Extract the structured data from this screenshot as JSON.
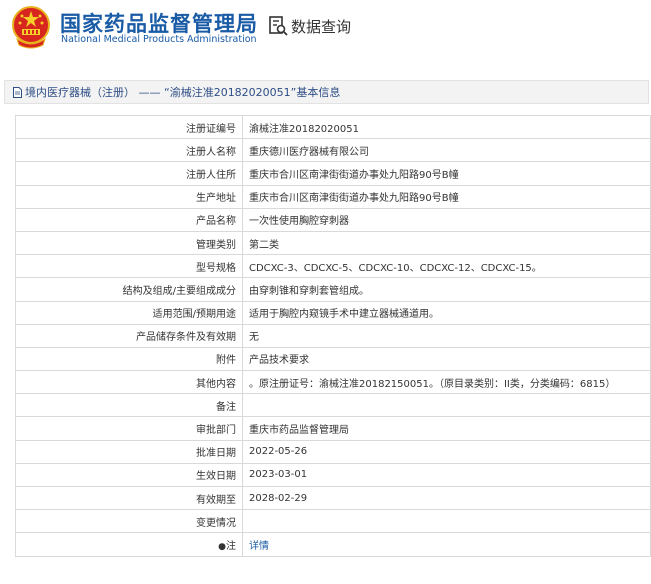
{
  "header": {
    "site_title_cn": "国家药品监督管理局",
    "site_title_en": "National Medical Products Administration",
    "query_label": "数据查询",
    "query_icon": "search-document-icon",
    "emblem_icon": "national-emblem-icon"
  },
  "breadcrumb": {
    "text": "境内医疗器械（注册） —— “渝械注准20182020051”基本信息",
    "icon": "document-icon"
  },
  "rows": [
    {
      "label": "注册证编号",
      "value": "渝械注准20182020051"
    },
    {
      "label": "注册人名称",
      "value": "重庆德川医疗器械有限公司"
    },
    {
      "label": "注册人住所",
      "value": "重庆市合川区南津街街道办事处九阳路90号B幢"
    },
    {
      "label": "生产地址",
      "value": "重庆市合川区南津街街道办事处九阳路90号B幢"
    },
    {
      "label": "产品名称",
      "value": "一次性使用胸腔穿刺器"
    },
    {
      "label": "管理类别",
      "value": "第二类"
    },
    {
      "label": "型号规格",
      "value": "CDCXC-3、CDCXC-5、CDCXC-10、CDCXC-12、CDCXC-15。"
    },
    {
      "label": "结构及组成/主要组成成分",
      "value": "由穿刺锥和穿刺套管组成。"
    },
    {
      "label": "适用范围/预期用途",
      "value": "适用于胸腔内窥镜手术中建立器械通道用。"
    },
    {
      "label": "产品储存条件及有效期",
      "value": "无"
    },
    {
      "label": "附件",
      "value": "产品技术要求"
    },
    {
      "label": "其他内容",
      "value": "。原注册证号：渝械注准20182150051。（原目录类别：II类，分类编码：6815）"
    },
    {
      "label": "备注",
      "value": ""
    },
    {
      "label": "审批部门",
      "value": "重庆市药品监督管理局"
    },
    {
      "label": "批准日期",
      "value": "2022-05-26"
    },
    {
      "label": "生效日期",
      "value": "2023-03-01"
    },
    {
      "label": "有效期至",
      "value": "2028-02-29"
    },
    {
      "label": "变更情况",
      "value": ""
    }
  ],
  "note_row": {
    "pin_icon": "pin-icon",
    "pin": "●",
    "label": "注",
    "link": "详情"
  }
}
